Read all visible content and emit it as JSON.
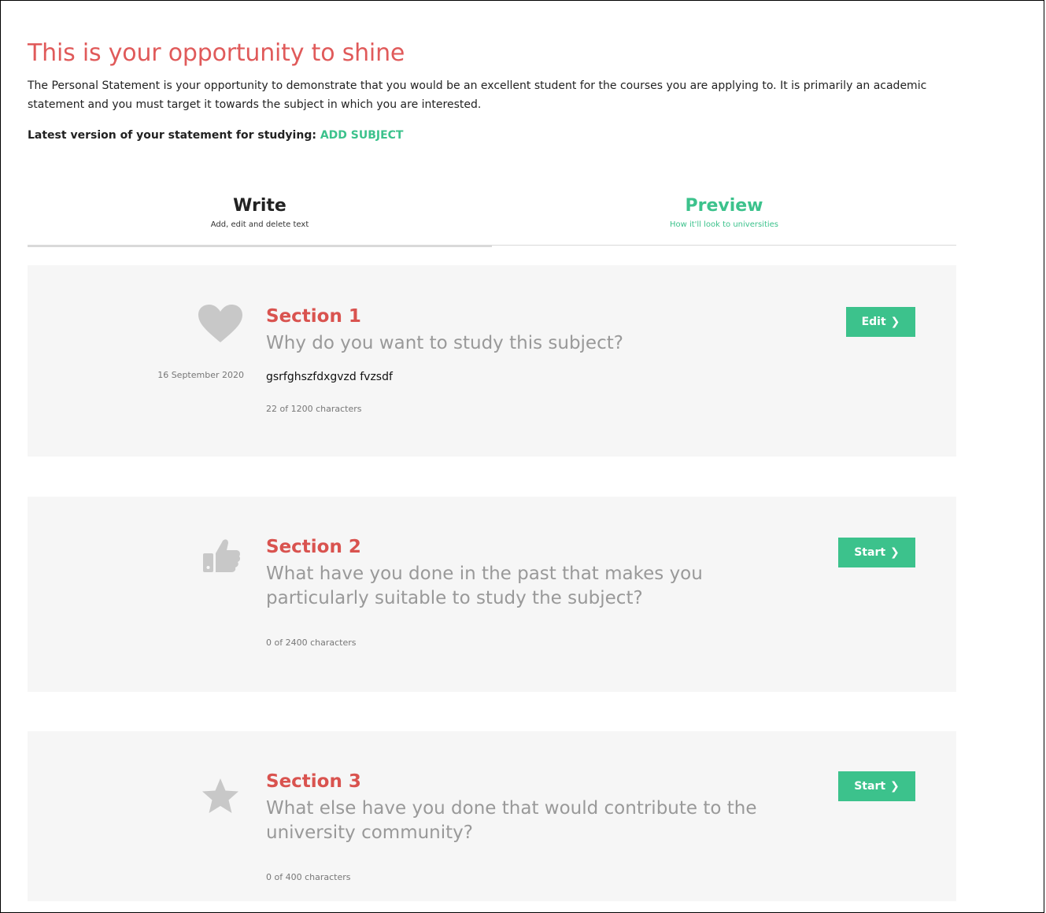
{
  "header": {
    "title": "This is your opportunity to shine",
    "intro": "The Personal Statement is your opportunity to demonstrate that you would be an excellent student for the courses you are applying to. It is primarily an academic statement and you must target it towards the subject in which you are interested.",
    "latest_label": "Latest version of your statement for studying:",
    "add_subject": "ADD SUBJECT"
  },
  "tabs": [
    {
      "title": "Write",
      "subtitle": "Add, edit and delete text",
      "active": true
    },
    {
      "title": "Preview",
      "subtitle": "How it'll look to universities",
      "active": false
    }
  ],
  "sections": [
    {
      "label": "Section 1",
      "question": "Why do you want to study this subject?",
      "date": "16 September 2020",
      "answer": "gsrfghszfdxgvzd fvzsdf",
      "count": "22 of 1200 characters",
      "button": "Edit",
      "icon": "heart-icon"
    },
    {
      "label": "Section 2",
      "question": "What have you done in the past that makes you particularly suitable to study the subject?",
      "count": "0 of 2400 characters",
      "button": "Start",
      "icon": "thumbs-up-icon"
    },
    {
      "label": "Section 3",
      "question": "What else have you done that would contribute to the university community?",
      "count": "0 of 400 characters",
      "button": "Start",
      "icon": "star-icon"
    }
  ],
  "colors": {
    "title": "#e05a5a",
    "section_label": "#d9534f",
    "accent": "#3cc28c",
    "card_bg": "#f6f6f6",
    "icon": "#c8c8c8"
  }
}
